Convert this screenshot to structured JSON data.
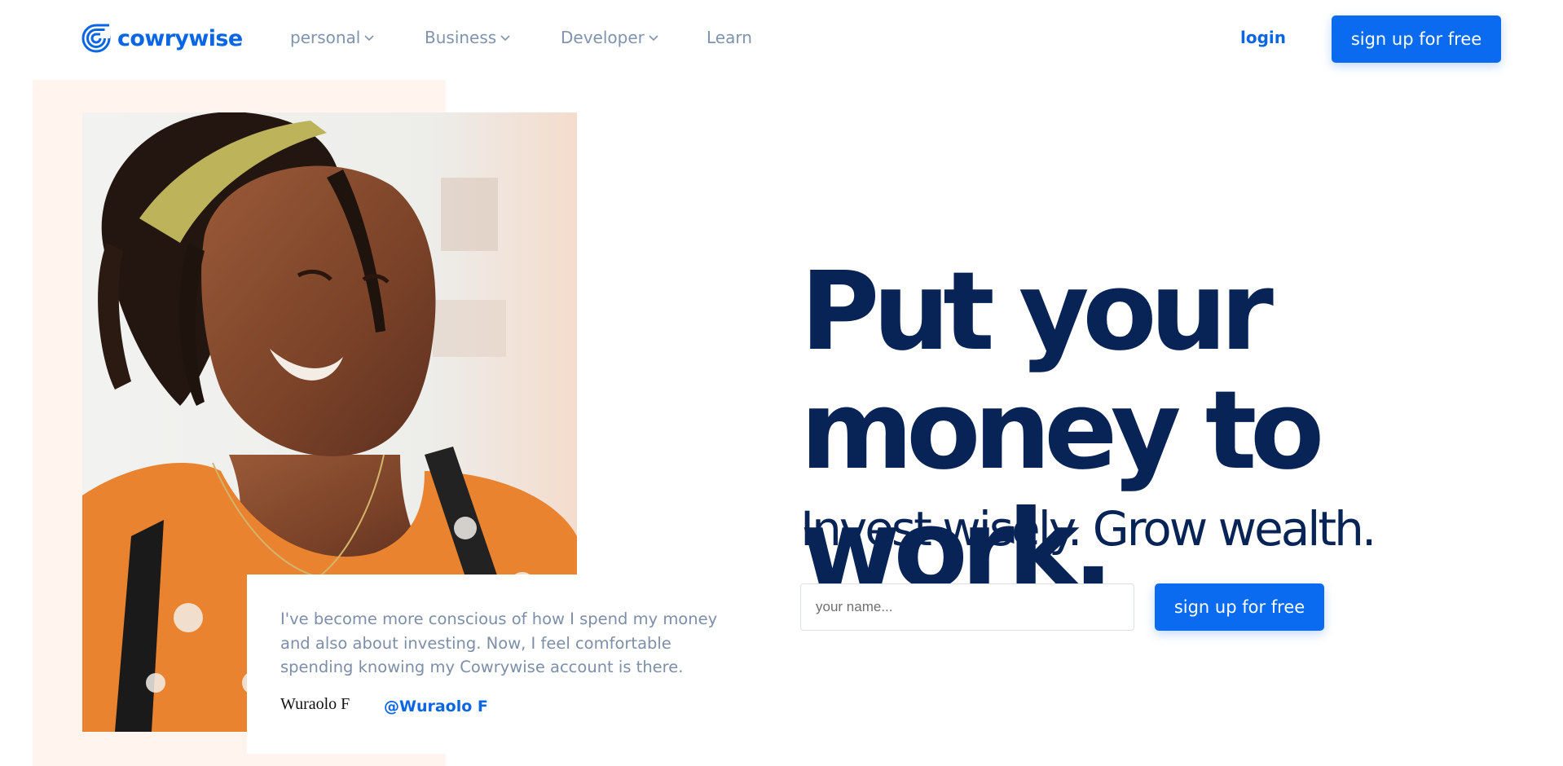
{
  "brand": {
    "name": "cowrywise",
    "accent": "#0a66e4",
    "navy": "#082456"
  },
  "nav": {
    "items": [
      {
        "label": "personal",
        "dropdown": true
      },
      {
        "label": "Business",
        "dropdown": true
      },
      {
        "label": "Developer",
        "dropdown": true
      },
      {
        "label": "Learn",
        "dropdown": false
      }
    ],
    "login_label": "login",
    "signup_label": "sign up for free"
  },
  "hero": {
    "title_line1": "Put your",
    "title_line2": "money to work.",
    "subtitle": "Invest wisely. Grow wealth.",
    "name_placeholder": "your name...",
    "signup_label": "sign up for free"
  },
  "testimonial": {
    "quote": "I've become more conscious of how I spend my money and also about investing. Now, I feel comfortable spending knowing my Cowrywise account is there.",
    "name": "Wuraolo F",
    "handle": "@Wuraolo F"
  },
  "icons": {
    "logo": "concentric-spiral-icon",
    "dropdown": "chevron-down-icon"
  }
}
